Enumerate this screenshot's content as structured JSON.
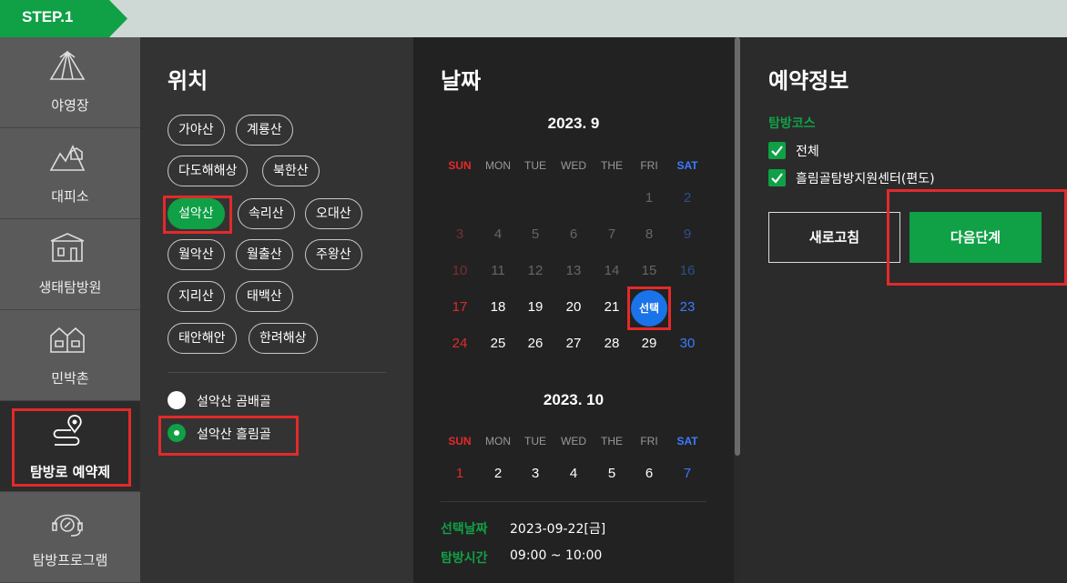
{
  "step": {
    "label": "STEP.1"
  },
  "sidebar": {
    "items": [
      {
        "label": "야영장",
        "icon": "tent-icon"
      },
      {
        "label": "대피소",
        "icon": "shelter-icon"
      },
      {
        "label": "생태탐방원",
        "icon": "eco-center-icon"
      },
      {
        "label": "민박촌",
        "icon": "village-icon"
      },
      {
        "label": "탐방로 예약제",
        "icon": "trail-pin-icon"
      },
      {
        "label": "탐방프로그램",
        "icon": "program-headset-icon"
      }
    ]
  },
  "location": {
    "title": "위치",
    "mountains": [
      "가야산",
      "계룡산",
      "다도해해상",
      "북한산",
      "설악산",
      "속리산",
      "오대산",
      "월악산",
      "월출산",
      "주왕산",
      "지리산",
      "태백산",
      "태안해안",
      "한려해상"
    ],
    "selected_mountain": "설악산",
    "courses": [
      {
        "label": "설악산 곰배골",
        "selected": false
      },
      {
        "label": "설악산 흘림골",
        "selected": true
      }
    ]
  },
  "date": {
    "title": "날짜",
    "weekdays": [
      "SUN",
      "MON",
      "TUE",
      "WED",
      "THE",
      "FRI",
      "SAT"
    ],
    "month1": {
      "title": "2023. 9",
      "rows": [
        [
          "",
          "",
          "",
          "",
          "",
          "1",
          "2"
        ],
        [
          "3",
          "4",
          "5",
          "6",
          "7",
          "8",
          "9"
        ],
        [
          "10",
          "11",
          "12",
          "13",
          "14",
          "15",
          "16"
        ],
        [
          "17",
          "18",
          "19",
          "20",
          "21",
          "선택",
          "23"
        ],
        [
          "24",
          "25",
          "26",
          "27",
          "28",
          "29",
          "30"
        ]
      ]
    },
    "month2": {
      "title": "2023. 10",
      "rows": [
        [
          "1",
          "2",
          "3",
          "4",
          "5",
          "6",
          "7"
        ]
      ]
    },
    "selected_label": "선택날짜",
    "selected_value": "2023-09-22[금]",
    "time_label": "탐방시간",
    "time_value": "09:00 ~ 10:00"
  },
  "reservation": {
    "title": "예약정보",
    "course_label": "탐방코스",
    "options": [
      {
        "label": "전체",
        "checked": true
      },
      {
        "label": "흘림골탐방지원센터(편도)",
        "checked": true
      }
    ],
    "refresh_label": "새로고침",
    "next_label": "다음단계"
  },
  "colors": {
    "accent_green": "#10a046",
    "highlight_red": "#e32a2a",
    "select_blue": "#1a73e8",
    "sunday_red": "#e32a2a",
    "saturday_blue": "#3a7cff"
  }
}
